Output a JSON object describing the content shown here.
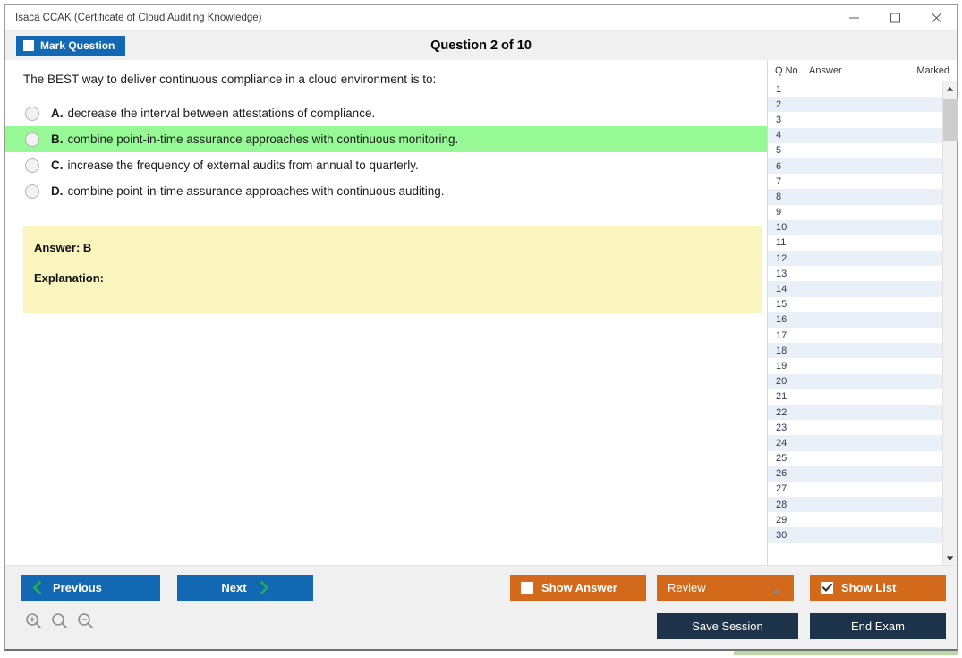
{
  "window": {
    "title": "Isaca CCAK (Certificate of Cloud Auditing Knowledge)",
    "controls": {
      "minimize": "minimize-icon",
      "maximize": "maximize-icon",
      "close": "close-icon"
    }
  },
  "header": {
    "mark_question_label": "Mark Question",
    "mark_question_checked": false,
    "question_counter": "Question 2 of 10"
  },
  "question": {
    "stem": "The BEST way to deliver continuous compliance in a cloud environment is to:",
    "options": [
      {
        "letter": "A.",
        "text": "decrease the interval between attestations of compliance.",
        "highlighted": false
      },
      {
        "letter": "B.",
        "text": "combine point-in-time assurance approaches with continuous monitoring.",
        "highlighted": true
      },
      {
        "letter": "C.",
        "text": "increase the frequency of external audits from annual to quarterly.",
        "highlighted": false
      },
      {
        "letter": "D.",
        "text": "combine point-in-time assurance approaches with continuous auditing.",
        "highlighted": false
      }
    ]
  },
  "answer_panel": {
    "answer_label": "Answer: B",
    "explanation_label": "Explanation:"
  },
  "question_list": {
    "columns": [
      "Q No.",
      "Answer",
      "Marked"
    ],
    "rows": [
      {
        "no": "1",
        "answer": "",
        "marked": ""
      },
      {
        "no": "2",
        "answer": "",
        "marked": ""
      },
      {
        "no": "3",
        "answer": "",
        "marked": ""
      },
      {
        "no": "4",
        "answer": "",
        "marked": ""
      },
      {
        "no": "5",
        "answer": "",
        "marked": ""
      },
      {
        "no": "6",
        "answer": "",
        "marked": ""
      },
      {
        "no": "7",
        "answer": "",
        "marked": ""
      },
      {
        "no": "8",
        "answer": "",
        "marked": ""
      },
      {
        "no": "9",
        "answer": "",
        "marked": ""
      },
      {
        "no": "10",
        "answer": "",
        "marked": ""
      },
      {
        "no": "11",
        "answer": "",
        "marked": ""
      },
      {
        "no": "12",
        "answer": "",
        "marked": ""
      },
      {
        "no": "13",
        "answer": "",
        "marked": ""
      },
      {
        "no": "14",
        "answer": "",
        "marked": ""
      },
      {
        "no": "15",
        "answer": "",
        "marked": ""
      },
      {
        "no": "16",
        "answer": "",
        "marked": ""
      },
      {
        "no": "17",
        "answer": "",
        "marked": ""
      },
      {
        "no": "18",
        "answer": "",
        "marked": ""
      },
      {
        "no": "19",
        "answer": "",
        "marked": ""
      },
      {
        "no": "20",
        "answer": "",
        "marked": ""
      },
      {
        "no": "21",
        "answer": "",
        "marked": ""
      },
      {
        "no": "22",
        "answer": "",
        "marked": ""
      },
      {
        "no": "23",
        "answer": "",
        "marked": ""
      },
      {
        "no": "24",
        "answer": "",
        "marked": ""
      },
      {
        "no": "25",
        "answer": "",
        "marked": ""
      },
      {
        "no": "26",
        "answer": "",
        "marked": ""
      },
      {
        "no": "27",
        "answer": "",
        "marked": ""
      },
      {
        "no": "28",
        "answer": "",
        "marked": ""
      },
      {
        "no": "29",
        "answer": "",
        "marked": ""
      },
      {
        "no": "30",
        "answer": "",
        "marked": ""
      }
    ]
  },
  "footer": {
    "previous_label": "Previous",
    "next_label": "Next",
    "show_answer_label": "Show Answer",
    "show_answer_checked": false,
    "review_label": "Review",
    "show_list_label": "Show List",
    "show_list_checked": true,
    "save_session_label": "Save Session",
    "end_exam_label": "End Exam",
    "zoom_icons": [
      "zoom-in-icon",
      "zoom-reset-icon",
      "zoom-out-icon"
    ]
  },
  "colors": {
    "primary_blue": "#1268b3",
    "accent_orange": "#d2691b",
    "navy": "#1d3349",
    "correct_green": "#96f996",
    "answer_yellow": "#faf4be",
    "chevron_green": "#22b14c"
  }
}
